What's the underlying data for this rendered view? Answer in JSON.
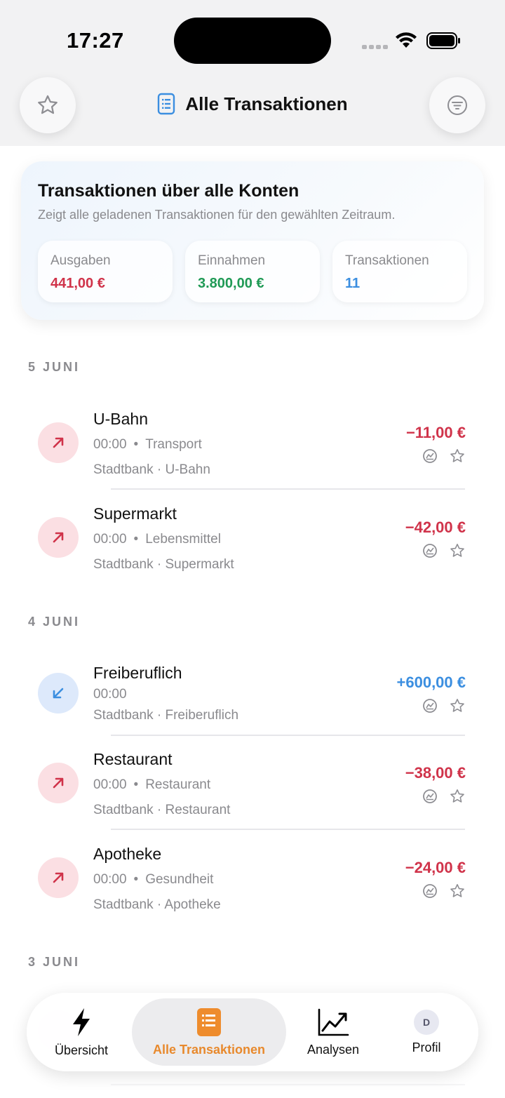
{
  "status": {
    "time": "17:27"
  },
  "header": {
    "title": "Alle Transaktionen",
    "favorite_icon": "star-icon",
    "filter_icon": "filter-icon"
  },
  "summary": {
    "title": "Transaktionen über alle Konten",
    "subtitle": "Zeigt alle geladenen Transaktionen für den gewählten Zeitraum.",
    "stats": [
      {
        "label": "Ausgaben",
        "value": "441,00 €",
        "color": "#d0334a"
      },
      {
        "label": "Einnahmen",
        "value": "3.800,00 €",
        "color": "#1f9a55"
      },
      {
        "label": "Transaktionen",
        "value": "11",
        "color": "#3b8ee0"
      }
    ]
  },
  "groups": [
    {
      "date": "5 JUNI",
      "transactions": [
        {
          "name": "U-Bahn",
          "time": "00:00",
          "category": "Transport",
          "account": "Stadtbank",
          "payee": "U-Bahn",
          "amount": "−11,00 €",
          "direction": "out"
        },
        {
          "name": "Supermarkt",
          "time": "00:00",
          "category": "Lebensmittel",
          "account": "Stadtbank",
          "payee": "Supermarkt",
          "amount": "−42,00 €",
          "direction": "out"
        }
      ]
    },
    {
      "date": "4 JUNI",
      "transactions": [
        {
          "name": "Freiberuflich",
          "time": "00:00",
          "category": "",
          "account": "Stadtbank",
          "payee": "Freiberuflich",
          "amount": "+600,00 €",
          "direction": "in"
        },
        {
          "name": "Restaurant",
          "time": "00:00",
          "category": "Restaurant",
          "account": "Stadtbank",
          "payee": "Restaurant",
          "amount": "−38,00 €",
          "direction": "out"
        },
        {
          "name": "Apotheke",
          "time": "00:00",
          "category": "Gesundheit",
          "account": "Stadtbank",
          "payee": "Apotheke",
          "amount": "−24,00 €",
          "direction": "out"
        }
      ]
    },
    {
      "date": "3 JUNI"
    }
  ],
  "meta_separator": "·",
  "tabbar": {
    "tabs": [
      {
        "label": "Übersicht",
        "icon": "bolt-icon"
      },
      {
        "label": "Alle Transaktionen",
        "icon": "list-icon",
        "active": true
      },
      {
        "label": "Analysen",
        "icon": "chart-line-icon"
      },
      {
        "label": "Profil",
        "icon": "avatar-icon",
        "avatar_initial": "D"
      }
    ]
  },
  "colors": {
    "expense": "#d0334a",
    "income": "#3b8ee0",
    "accent": "#e8892c"
  }
}
